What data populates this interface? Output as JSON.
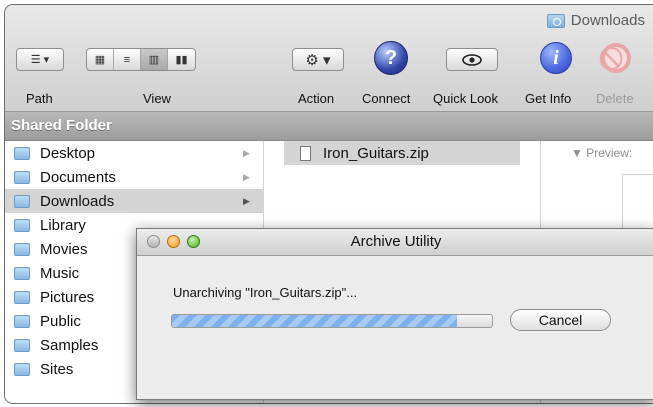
{
  "window": {
    "title": "Downloads",
    "title_icon": "folder-icon"
  },
  "toolbar": {
    "path_label": "Path",
    "view_label": "View",
    "action_label": "Action",
    "connect_label": "Connect",
    "quicklook_label": "Quick Look",
    "getinfo_label": "Get Info",
    "delete_label": "Delete",
    "view_modes": [
      "icon",
      "list",
      "columns",
      "coverflow"
    ],
    "active_view_mode": "columns"
  },
  "sidebar_header": "Shared Folder",
  "column1": {
    "items": [
      {
        "label": "Desktop",
        "has_children": true
      },
      {
        "label": "Documents",
        "has_children": true
      },
      {
        "label": "Downloads",
        "has_children": true,
        "selected": true
      },
      {
        "label": "Library",
        "has_children": false
      },
      {
        "label": "Movies",
        "has_children": false
      },
      {
        "label": "Music",
        "has_children": false
      },
      {
        "label": "Pictures",
        "has_children": false
      },
      {
        "label": "Public",
        "has_children": false
      },
      {
        "label": "Samples",
        "has_children": false
      },
      {
        "label": "Sites",
        "has_children": false
      }
    ]
  },
  "column2": {
    "file": "Iron_Guitars.zip"
  },
  "preview": {
    "label": "▼ Preview:"
  },
  "dialog": {
    "title": "Archive Utility",
    "message": "Unarchiving \"Iron_Guitars.zip\"...",
    "progress": 0.89,
    "cancel_label": "Cancel"
  },
  "colors": {
    "selection": "#d4d4d4",
    "progress": "#7fb0ec",
    "header_bar": "#a9a9a9"
  }
}
